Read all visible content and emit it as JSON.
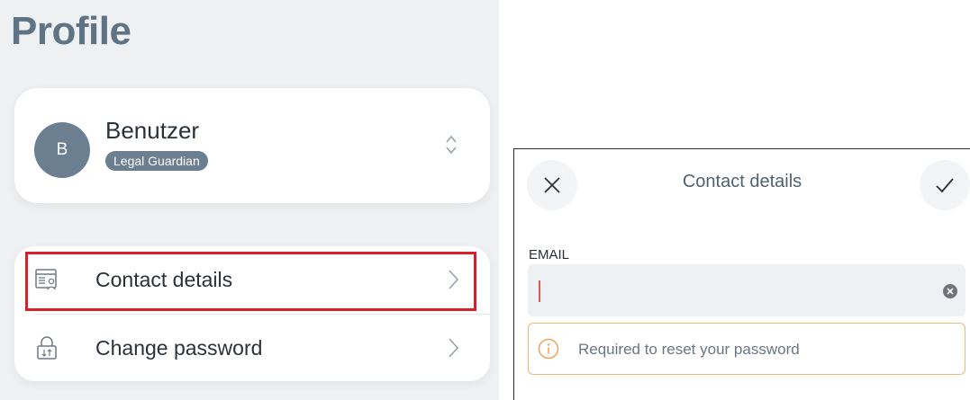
{
  "profile": {
    "title": "Profile",
    "user": {
      "initial": "B",
      "name": "Benutzer",
      "role": "Legal Guardian"
    },
    "menu": [
      {
        "label": "Contact details",
        "icon": "contact-card-icon"
      },
      {
        "label": "Change password",
        "icon": "lock-icon"
      }
    ]
  },
  "contact_details": {
    "title": "Contact details",
    "email_label": "EMAIL",
    "email_value": "",
    "hint": "Required to reset your password"
  },
  "colors": {
    "accent": "#6b7f90",
    "title": "#5f7384",
    "highlight": "#d8202a",
    "hint_border": "#f0b67a",
    "caret": "#e1584a"
  }
}
